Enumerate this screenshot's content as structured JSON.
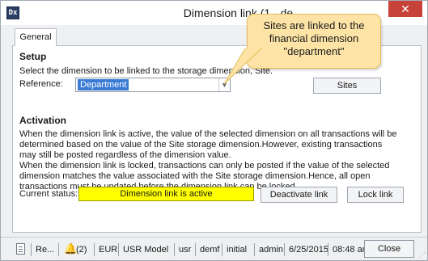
{
  "window": {
    "title": "Dimension link (1 - de",
    "app_icon_text": "Dx"
  },
  "tabs": [
    {
      "label": "General"
    }
  ],
  "setup": {
    "title": "Setup",
    "description": "Select the dimension to be linked to the storage dimension, Site.",
    "reference_label": "Reference:",
    "reference_value": "Department",
    "sites_button": "Sites"
  },
  "activation": {
    "title": "Activation",
    "para1": "When the dimension link is active, the value of the selected dimension on all transactions will be determined based on the value of the Site storage dimension.However, existing transactions may still be posted regardless of the dimension value.",
    "para2": "When the dimension link is locked, transactions can only be posted if the value of the selected dimension matches the value associated with the Site storage dimension.Hence, all open transactions must be updated before the dimension link can be locked.",
    "current_status_label": "Current status:",
    "current_status_value": "Dimension link is active",
    "deactivate_button": "Deactivate link",
    "lock_button": "Lock link"
  },
  "statusbar": {
    "items": [
      "Re...",
      "(2)",
      "EUR",
      "USR Model",
      "usr",
      "demf",
      "initial",
      "admin",
      "6/25/2015",
      "08:48 am"
    ],
    "close_button": "Close"
  },
  "callout": {
    "text": "Sites are linked to the financial dimension \"department\""
  },
  "colors": {
    "status_highlight": "#ffff00",
    "selection": "#3a7bd5",
    "callout_fill": "#fde4a6",
    "close_red": "#c7433a"
  }
}
